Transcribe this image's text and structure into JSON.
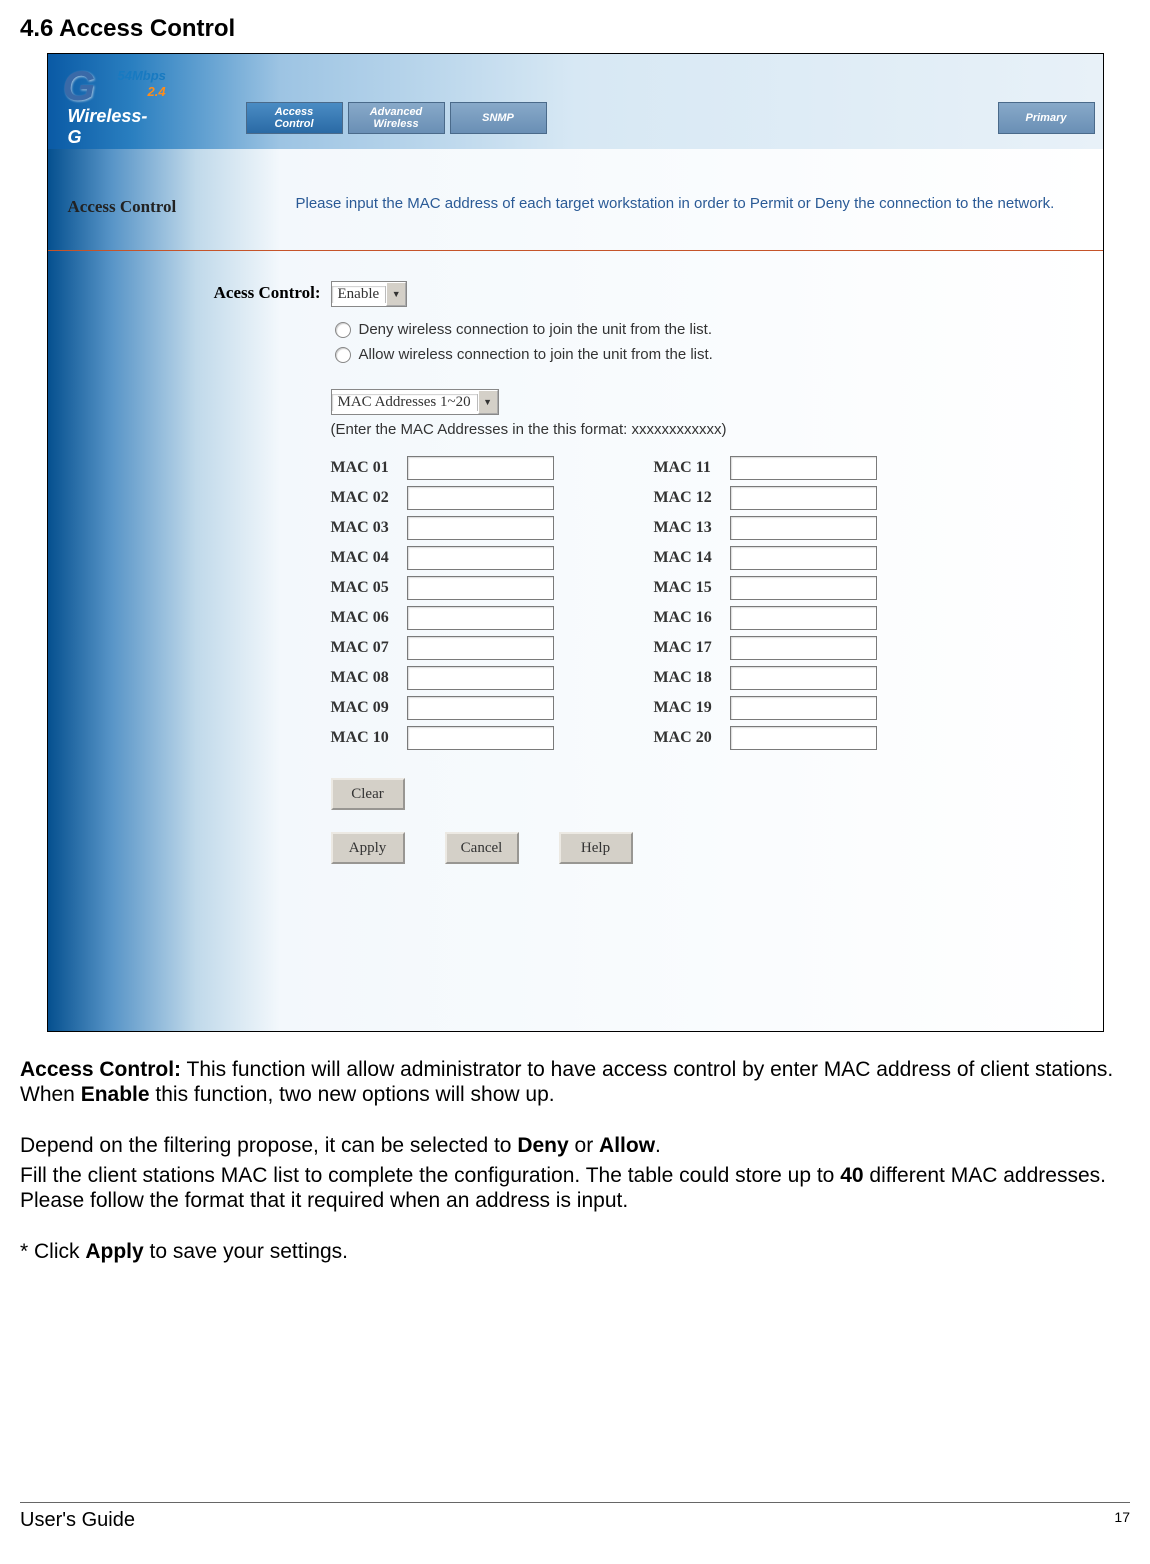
{
  "doc": {
    "section_title": "4.6 Access Control",
    "footer_left": "User's Guide",
    "page_number": "17",
    "body1_pre": "Access Control:",
    "body1_post": " This function will allow administrator to have access control by enter MAC address of client stations. When ",
    "body1_bold2": "Enable",
    "body1_tail": " this function, two new options will show up.",
    "body2_pre": "Depend on the filtering propose, it can be selected to ",
    "body2_bold1": "Deny",
    "body2_mid": " or ",
    "body2_bold2": "Allow",
    "body2_end": ".",
    "body3_pre": "Fill the client stations MAC list to complete the configuration. The table could store up to ",
    "body3_bold": "40",
    "body3_end": " different MAC addresses. Please follow the format that it required when an address is input.",
    "body4_pre": "* Click ",
    "body4_bold": "Apply",
    "body4_end": " to save your settings."
  },
  "banner": {
    "g": "G",
    "rate": "54Mbps",
    "sub": "2.4",
    "wg": "Wireless-G",
    "tabs": [
      "Access\nControl",
      "Advanced\nWireless",
      "SNMP"
    ],
    "tab_right": "Primary"
  },
  "section": {
    "label": "Access Control",
    "text": "Please input the MAC address of each target workstation in order to Permit or Deny the connection to the network."
  },
  "form": {
    "label": "Acess Control:",
    "dropdown1": "Enable",
    "radio1": "Deny wireless connection to join the unit from the list.",
    "radio2": "Allow wireless connection to join the unit from the list.",
    "dropdown2": "MAC Addresses 1~20",
    "hint": "(Enter the MAC Addresses in the this format: xxxxxxxxxxxx)",
    "mac_left": [
      "MAC 01",
      "MAC 02",
      "MAC 03",
      "MAC 04",
      "MAC 05",
      "MAC 06",
      "MAC 07",
      "MAC 08",
      "MAC 09",
      "MAC 10"
    ],
    "mac_right": [
      "MAC 11",
      "MAC 12",
      "MAC 13",
      "MAC 14",
      "MAC 15",
      "MAC 16",
      "MAC 17",
      "MAC 18",
      "MAC 19",
      "MAC 20"
    ],
    "btn_clear": "Clear",
    "btn_apply": "Apply",
    "btn_cancel": "Cancel",
    "btn_help": "Help"
  }
}
